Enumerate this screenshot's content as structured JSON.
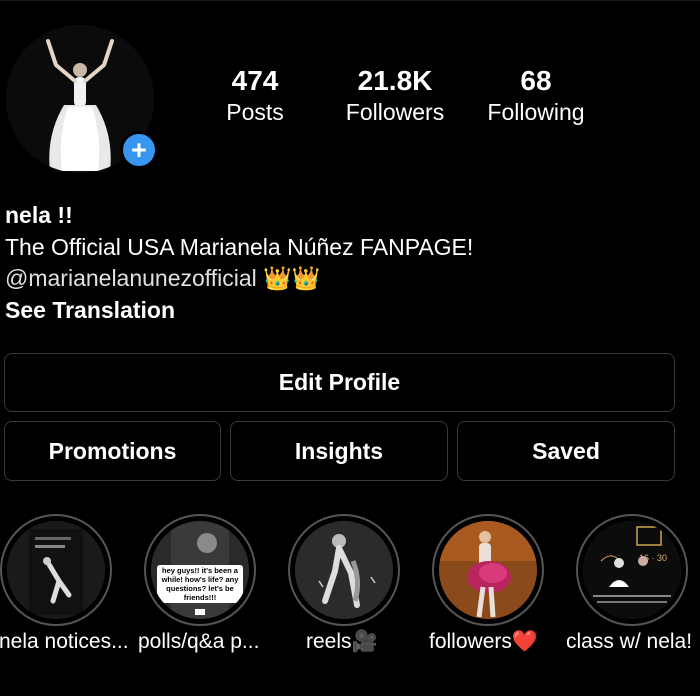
{
  "profile": {
    "stats": {
      "posts_count": "474",
      "posts_label": "Posts",
      "followers_count": "21.8K",
      "followers_label": "Followers",
      "following_count": "68",
      "following_label": "Following"
    },
    "bio": {
      "name": "nela !!",
      "line1": "The Official USA Marianela Núñez FANPAGE!",
      "mention": "@marianelanunezofficial",
      "emoji": "👑👑",
      "see_translation": "See Translation"
    },
    "add_icon": "plus-icon"
  },
  "buttons": {
    "edit_profile": "Edit Profile",
    "promotions": "Promotions",
    "insights": "Insights",
    "saved": "Saved"
  },
  "highlights": [
    {
      "label": "nela notices..."
    },
    {
      "label": "polls/q&a p...",
      "story_text": "hey guys!! it's been a while! how's life? any questions? let's be friends!!!"
    },
    {
      "label": "reels🎥"
    },
    {
      "label": "followers❤️"
    },
    {
      "label": "class w/ nela!",
      "story_text": "16 · 30"
    }
  ],
  "colors": {
    "accent": "#3797f0",
    "background": "#000000",
    "border": "#3a3a3a"
  }
}
